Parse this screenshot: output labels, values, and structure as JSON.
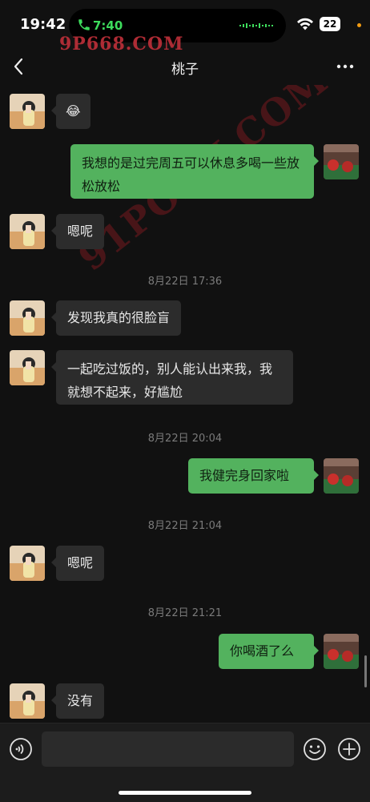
{
  "status": {
    "time": "19:42",
    "call_time": "7:40",
    "battery": "22"
  },
  "watermark": "9P668.COM",
  "watermark_diagonal": "91PORN.COM",
  "nav": {
    "title": "桃子"
  },
  "messages": [
    {
      "side": "in",
      "text": "😂"
    },
    {
      "side": "out",
      "text": "我想的是过完周五可以休息多喝一些放松放松"
    },
    {
      "side": "in",
      "text": "嗯呢"
    },
    {
      "timestamp": "8月22日 17:36"
    },
    {
      "side": "in",
      "text": "发现我真的很脸盲"
    },
    {
      "side": "in",
      "text": "一起吃过饭的，别人能认出来我，我就想不起来，好尴尬"
    },
    {
      "timestamp": "8月22日 20:04"
    },
    {
      "side": "out",
      "text": "我健完身回家啦"
    },
    {
      "timestamp": "8月22日 21:04"
    },
    {
      "side": "in",
      "text": "嗯呢"
    },
    {
      "timestamp": "8月22日 21:21"
    },
    {
      "side": "out",
      "text": "你喝酒了么"
    },
    {
      "side": "in",
      "text": "没有"
    }
  ],
  "colors": {
    "background": "#111111",
    "bubble_out": "#53b25e",
    "bubble_in": "#2c2c2c"
  },
  "icons": [
    "phone-icon",
    "wifi-icon",
    "back-icon",
    "more-icon",
    "voice-icon",
    "emoji-icon",
    "plus-icon"
  ]
}
